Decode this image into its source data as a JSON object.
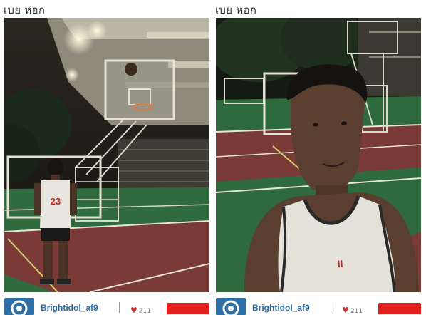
{
  "posts": [
    {
      "caption": "เบย หอก",
      "photo_description": "Night photo of a basketball player in a white jersey number 23 standing on an outdoor basketball court, facing a backboard and hoop under stadium lights",
      "username": "Brightidol_af9",
      "like_count": "211",
      "icons": {
        "avatar": "avatar-logo-icon",
        "like": "heart-icon"
      }
    },
    {
      "caption": "เบย หอก",
      "photo_description": "Night selfie of a young man in a white sleeveless jersey on an outdoor basketball court with a soccer goal and hoop behind him",
      "username": "Brightidol_af9",
      "like_count": "211",
      "icons": {
        "avatar": "avatar-logo-icon",
        "like": "heart-icon"
      }
    }
  ],
  "colors": {
    "username": "#2d6aa3",
    "heart": "#c9363d",
    "follow_button": "#e0201c",
    "court_green": "#2f6b3c",
    "court_red": "#7a3a36"
  }
}
